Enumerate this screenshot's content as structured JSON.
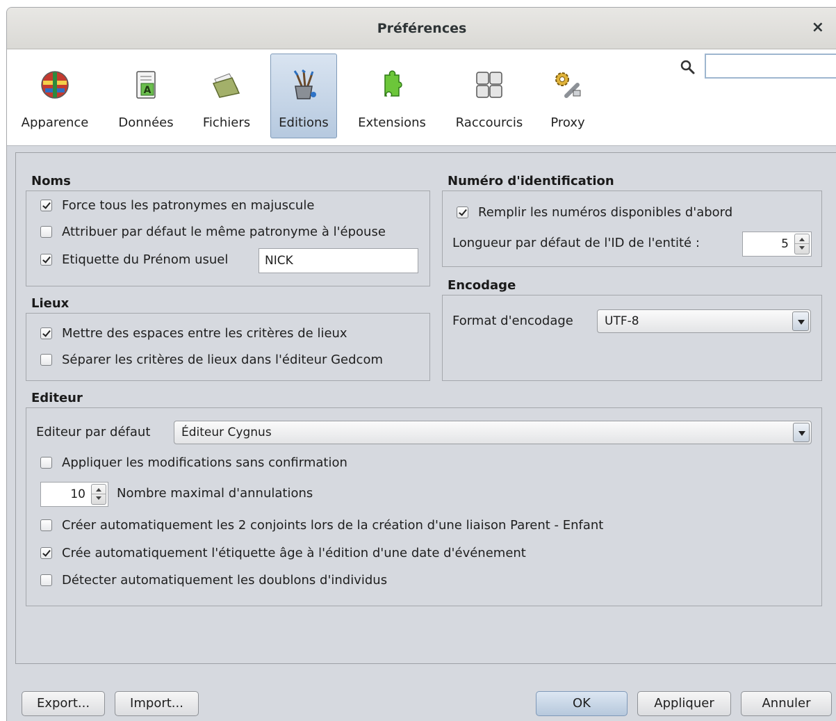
{
  "window": {
    "title": "Préférences",
    "close_glyph": "×"
  },
  "toolbar": {
    "items": [
      {
        "label": "Apparence",
        "icon": "globe-flags-icon",
        "selected": false
      },
      {
        "label": "Données",
        "icon": "document-letter-icon",
        "selected": false
      },
      {
        "label": "Fichiers",
        "icon": "folder-files-icon",
        "selected": false
      },
      {
        "label": "Editions",
        "icon": "paint-brushes-icon",
        "selected": true
      },
      {
        "label": "Extensions",
        "icon": "puzzle-piece-icon",
        "selected": false
      },
      {
        "label": "Raccourcis",
        "icon": "keyboard-keys-icon",
        "selected": false
      },
      {
        "label": "Proxy",
        "icon": "gear-wrench-icon",
        "selected": false
      }
    ],
    "search": {
      "value": "",
      "placeholder": ""
    }
  },
  "noms": {
    "title": "Noms",
    "force_upper": {
      "label": "Force tous les patronymes en majuscule",
      "checked": true
    },
    "same_surname": {
      "label": "Attribuer par défaut le même patronyme à l'épouse",
      "checked": false
    },
    "nick_label": {
      "label": "Etiquette du Prénom usuel",
      "checked": true,
      "value": "NICK"
    }
  },
  "lieux": {
    "title": "Lieux",
    "spaces": {
      "label": "Mettre des espaces entre les critères de lieux",
      "checked": true
    },
    "separate": {
      "label": "Séparer les critères de lieux dans l'éditeur Gedcom",
      "checked": false
    }
  },
  "numero": {
    "title": "Numéro d'identification",
    "fill_available": {
      "label": "Remplir les numéros disponibles d'abord",
      "checked": true
    },
    "id_length": {
      "label": "Longueur par défaut de l'ID de l'entité :",
      "value": "5"
    }
  },
  "encodage": {
    "title": "Encodage",
    "format_label": "Format d'encodage",
    "format_value": "UTF-8"
  },
  "editeur": {
    "title": "Editeur",
    "default_label": "Editeur par défaut",
    "default_value": "Éditeur Cygnus",
    "apply_no_confirm": {
      "label": "Appliquer les modifications sans confirmation",
      "checked": false
    },
    "undo_count": {
      "value": "10",
      "label": "Nombre maximal d'annulations"
    },
    "auto_spouses": {
      "label": "Créer automatiquement les 2 conjoints lors de la création d'une liaison Parent - Enfant",
      "checked": false
    },
    "auto_age": {
      "label": "Crée automatiquement l'étiquette âge à l'édition d'une date d'événement",
      "checked": true
    },
    "detect_duplicates": {
      "label": "Détecter automatiquement les doublons d'individus",
      "checked": false
    }
  },
  "buttons": {
    "export": "Export...",
    "import": "Import...",
    "ok": "OK",
    "apply": "Appliquer",
    "cancel": "Annuler"
  },
  "colors": {
    "dialog_bg": "#d6d9df",
    "selected_tab": "#b6c9df",
    "ok_button": "#b6c8dc"
  }
}
